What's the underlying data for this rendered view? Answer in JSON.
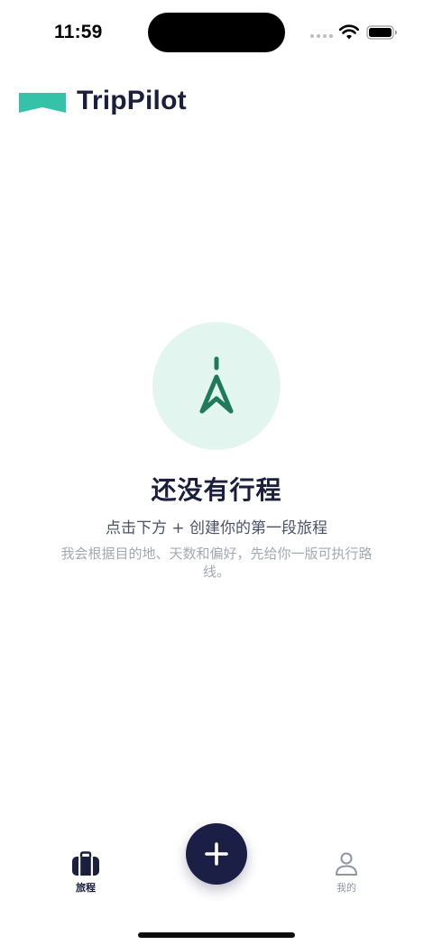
{
  "status_bar": {
    "time": "11:59",
    "icons": [
      "cellular-dots-icon",
      "wifi-icon",
      "battery-icon"
    ]
  },
  "header": {
    "logo_icon": "trippilot-logo-icon",
    "title": "TripPilot"
  },
  "empty_state": {
    "icon": "navigation-arrow-icon",
    "title": "还没有行程",
    "subtitle": "点击下方 + 创建你的第一段旅程",
    "description": "我会根据目的地、天数和偏好，先给你一版可执行路线。"
  },
  "tab_bar": {
    "tabs": [
      {
        "label": "旅程",
        "icon": "suitcase-icon",
        "active": true
      },
      {
        "label": "我的",
        "icon": "person-icon",
        "active": false
      }
    ],
    "fab_icon": "plus-icon"
  },
  "colors": {
    "brand_teal": "#34c3a8",
    "primary_navy": "#1c1f45",
    "accent_green": "#1f7a5c",
    "empty_circle_bg": "#e3f5ef"
  }
}
